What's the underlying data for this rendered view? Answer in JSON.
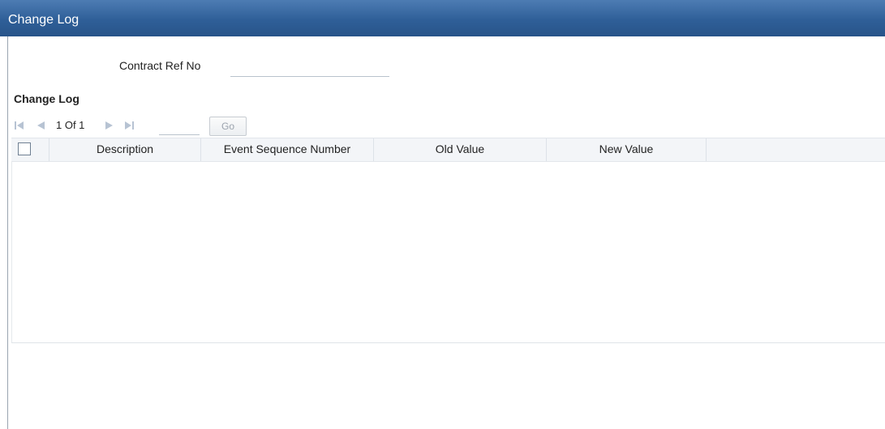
{
  "window": {
    "title": "Change Log"
  },
  "form": {
    "contract_ref_label": "Contract Ref No",
    "contract_ref_value": ""
  },
  "section": {
    "title": "Change Log"
  },
  "pager": {
    "page_text": "1 Of 1",
    "page_input_value": "",
    "go_label": "Go"
  },
  "grid": {
    "columns": [
      "Description",
      "Event Sequence Number",
      "Old Value",
      "New Value"
    ],
    "rows": []
  },
  "colors": {
    "titlebar": "#2f5f98",
    "header_bg": "#f3f5f8",
    "nav_icon_disabled": "#b7c3d3"
  },
  "icons": [
    "first-page-icon",
    "previous-page-icon",
    "next-page-icon",
    "last-page-icon"
  ]
}
